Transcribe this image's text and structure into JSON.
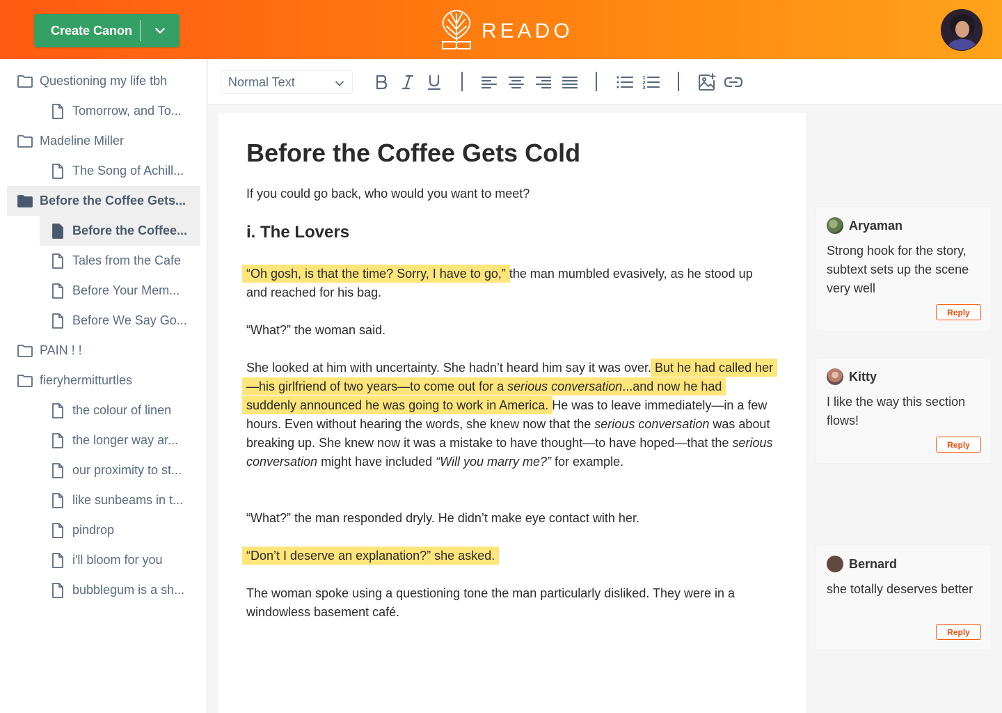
{
  "header": {
    "create_label": "Create Canon",
    "brand": "READO"
  },
  "sidebar": {
    "items": [
      {
        "label": "Questioning my life tbh",
        "kind": "folder"
      },
      {
        "label": "Tomorrow, and To...",
        "kind": "doc"
      },
      {
        "label": "Madeline Miller",
        "kind": "folder"
      },
      {
        "label": "The Song of Achill...",
        "kind": "doc"
      },
      {
        "label": "Before the Coffee Gets...",
        "kind": "folder"
      },
      {
        "label": "Before the Coffee...",
        "kind": "doc"
      },
      {
        "label": "Tales from the Cafe",
        "kind": "doc"
      },
      {
        "label": "Before Your Mem...",
        "kind": "doc"
      },
      {
        "label": "Before We Say Go...",
        "kind": "doc"
      },
      {
        "label": "PAIN ! !",
        "kind": "folder"
      },
      {
        "label": "fieryhermitturtles",
        "kind": "folder"
      },
      {
        "label": "the colour of linen",
        "kind": "doc"
      },
      {
        "label": "the longer way ar...",
        "kind": "doc"
      },
      {
        "label": "our proximity to st...",
        "kind": "doc"
      },
      {
        "label": "like sunbeams in t...",
        "kind": "doc"
      },
      {
        "label": "pindrop",
        "kind": "doc"
      },
      {
        "label": "i'll bloom for you",
        "kind": "doc"
      },
      {
        "label": "bubblegum is a sh...",
        "kind": "doc"
      }
    ]
  },
  "toolbar": {
    "text_style": "Normal Text",
    "icons": [
      "bold-icon",
      "italic-icon",
      "underline-icon",
      "align-left-icon",
      "align-center-icon",
      "align-right-icon",
      "align-justify-icon",
      "bullet-list-icon",
      "numbered-list-icon",
      "add-image-icon",
      "link-icon"
    ]
  },
  "document": {
    "title": "Before the Coffee Gets Cold",
    "subtitle": "If you could go back, who would you want to meet?",
    "section": "i. The Lovers",
    "p1_hl": "“Oh gosh, is that the time? Sorry, I have to go,”",
    "p1_rest": " the man mumbled evasively, as he stood up and reached for his bag.",
    "p2": "“What?” the woman said.",
    "p3_a": "She looked at him with uncertainty. She hadn’t heard him say it was over. ",
    "p3_hl_a": "But he had called her—his girlfriend of two years—to come out for a ",
    "p3_hl_em": "serious conversation",
    "p3_hl_b": "...and now he had suddenly announced he was going to work in America.",
    "p3_b": " He was to leave immediately—in a few hours. Even without hearing the words, she knew now that the ",
    "p3_em1": "serious conversation",
    "p3_c": " was about breaking up. She knew now it was a mistake to have thought—to have hoped—that the ",
    "p3_em2": "serious conversation",
    "p3_d": " might have included ",
    "p3_em3": "“Will you marry me?”",
    "p3_e": " for example.",
    "p4": "“What?” the man responded dryly. He didn’t make eye contact with her.",
    "p5_hl": "“Don’t I deserve an explanation?” she asked.",
    "p6": "The woman spoke using a questioning tone the man particularly disliked. They were in a windowless basement café."
  },
  "comments": [
    {
      "name": "Aryaman",
      "text": "Strong hook for the story, subtext sets up the scene very well",
      "reply": "Reply",
      "avatar_color": "#5d7a4e"
    },
    {
      "name": "Kitty",
      "text": "I like the way this section flows!",
      "reply": "Reply",
      "avatar_color": "#b87f6e"
    },
    {
      "name": "Bernard",
      "text": "she totally deserves better",
      "reply": "Reply",
      "avatar_color": "#5e4a3e"
    }
  ]
}
